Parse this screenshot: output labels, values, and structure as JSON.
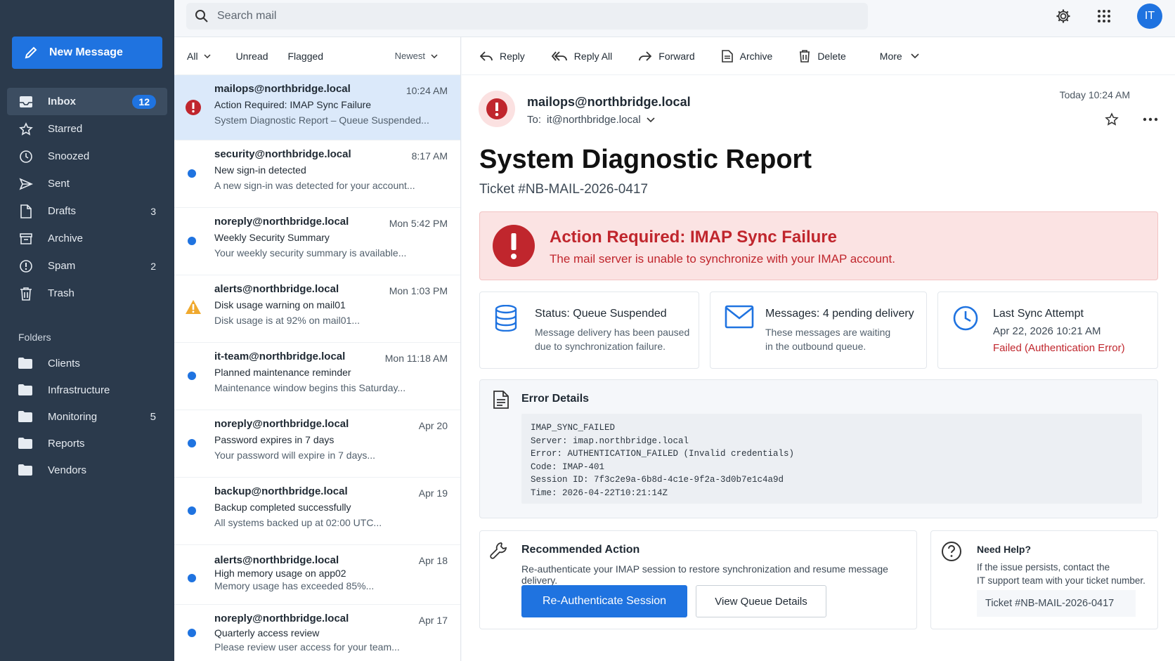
{
  "sidebar": {
    "new_message_label": "New Message",
    "nav": [
      {
        "label": "Inbox",
        "count": "12",
        "icon": "inbox-icon"
      },
      {
        "label": "Starred",
        "count": "",
        "icon": "star-icon"
      },
      {
        "label": "Snoozed",
        "count": "",
        "icon": "clock-icon"
      },
      {
        "label": "Sent",
        "count": "",
        "icon": "send-icon"
      },
      {
        "label": "Drafts",
        "count": "3",
        "icon": "draft-icon"
      },
      {
        "label": "Archive",
        "count": "",
        "icon": "archive-icon"
      },
      {
        "label": "Spam",
        "count": "2",
        "icon": "spam-icon"
      },
      {
        "label": "Trash",
        "count": "",
        "icon": "trash-icon"
      }
    ],
    "folders_heading": "Folders",
    "folders": [
      {
        "label": "Clients",
        "count": ""
      },
      {
        "label": "Infrastructure",
        "count": ""
      },
      {
        "label": "Monitoring",
        "count": "5"
      },
      {
        "label": "Reports",
        "count": ""
      },
      {
        "label": "Vendors",
        "count": ""
      }
    ]
  },
  "topbar": {
    "search_placeholder": "Search mail",
    "avatar_initials": "IT"
  },
  "list": {
    "filters": {
      "all": "All",
      "unread": "Unread",
      "flagged": "Flagged",
      "sort": "Newest"
    },
    "mails": [
      {
        "from": "mailops@northbridge.local",
        "time": "10:24 AM",
        "subject": "Action Required: IMAP Sync Failure",
        "preview": "System Diagnostic Report – Queue Suspended...",
        "marker": "error"
      },
      {
        "from": "security@northbridge.local",
        "time": "8:17 AM",
        "subject": "New sign-in detected",
        "preview": "A new sign-in was detected for your account...",
        "marker": "unread"
      },
      {
        "from": "noreply@northbridge.local",
        "time": "Mon 5:42 PM",
        "subject": "Weekly Security Summary",
        "preview": "Your weekly security summary is available...",
        "marker": "unread"
      },
      {
        "from": "alerts@northbridge.local",
        "time": "Mon 1:03 PM",
        "subject": "Disk usage warning on mail01",
        "preview": "Disk usage is at 92% on mail01...",
        "marker": "warning"
      },
      {
        "from": "it-team@northbridge.local",
        "time": "Mon 11:18 AM",
        "subject": "Planned maintenance reminder",
        "preview": "Maintenance window begins this Saturday...",
        "marker": "unread"
      },
      {
        "from": "noreply@northbridge.local",
        "time": "Apr 20",
        "subject": "Password expires in 7 days",
        "preview": "Your password will expire in 7 days...",
        "marker": "unread"
      },
      {
        "from": "backup@northbridge.local",
        "time": "Apr 19",
        "subject": "Backup completed successfully",
        "preview": "All systems backed up at 02:00 UTC...",
        "marker": "unread"
      },
      {
        "from": "alerts@northbridge.local",
        "time": "Apr 18",
        "subject": "High memory usage on app02",
        "preview": "Memory usage has exceeded 85%...",
        "marker": "unread"
      },
      {
        "from": "noreply@northbridge.local",
        "time": "Apr 17",
        "subject": "Quarterly access review",
        "preview": "Please review user access for your team...",
        "marker": "unread"
      }
    ]
  },
  "toolbar": {
    "reply": "Reply",
    "reply_all": "Reply All",
    "forward": "Forward",
    "archive": "Archive",
    "delete": "Delete",
    "more": "More"
  },
  "message": {
    "sender": "mailops@northbridge.local",
    "to_label": "To:",
    "to": "it@northbridge.local",
    "date": "Today 10:24 AM",
    "title": "System Diagnostic Report",
    "ticket": "Ticket #NB-MAIL-2026-0417",
    "alert_title": "Action Required: IMAP Sync Failure",
    "alert_sub": "The mail server is unable to synchronize with your IMAP account.",
    "cards": {
      "status_title": "Status: Queue Suspended",
      "status_l1": "Message delivery has been paused",
      "status_l2": "due to synchronization failure.",
      "msgs_title": "Messages: 4 pending delivery",
      "msgs_l1": "These messages are waiting",
      "msgs_l2": "in the outbound queue.",
      "sync_title": "Last Sync Attempt",
      "sync_time": "Apr 22, 2026 10:21 AM",
      "sync_status": "Failed (Authentication Error)"
    },
    "error_title": "Error Details",
    "error_lines": [
      "IMAP_SYNC_FAILED",
      "Server: imap.northbridge.local",
      "Error: AUTHENTICATION_FAILED (Invalid credentials)",
      "Code: IMAP-401",
      "Session ID: 7f3c2e9a-6b8d-4c1e-9f2a-3d0b7e1c4a9d",
      "Time: 2026-04-22T10:21:14Z"
    ],
    "rec_title": "Recommended Action",
    "rec_desc": "Re-authenticate your IMAP session to restore synchronization and resume message delivery.",
    "btn_reauth": "Re-Authenticate Session",
    "btn_queue": "View Queue Details",
    "help_title": "Need Help?",
    "help_l1": "If the issue persists, contact the",
    "help_l2": "IT support team with your ticket number.",
    "help_ticket": "Ticket #NB-MAIL-2026-0417"
  },
  "colors": {
    "accent": "#1f73e0",
    "sidebar": "#2b3a4c",
    "error": "#c0262d",
    "warning": "#f0a92e"
  }
}
